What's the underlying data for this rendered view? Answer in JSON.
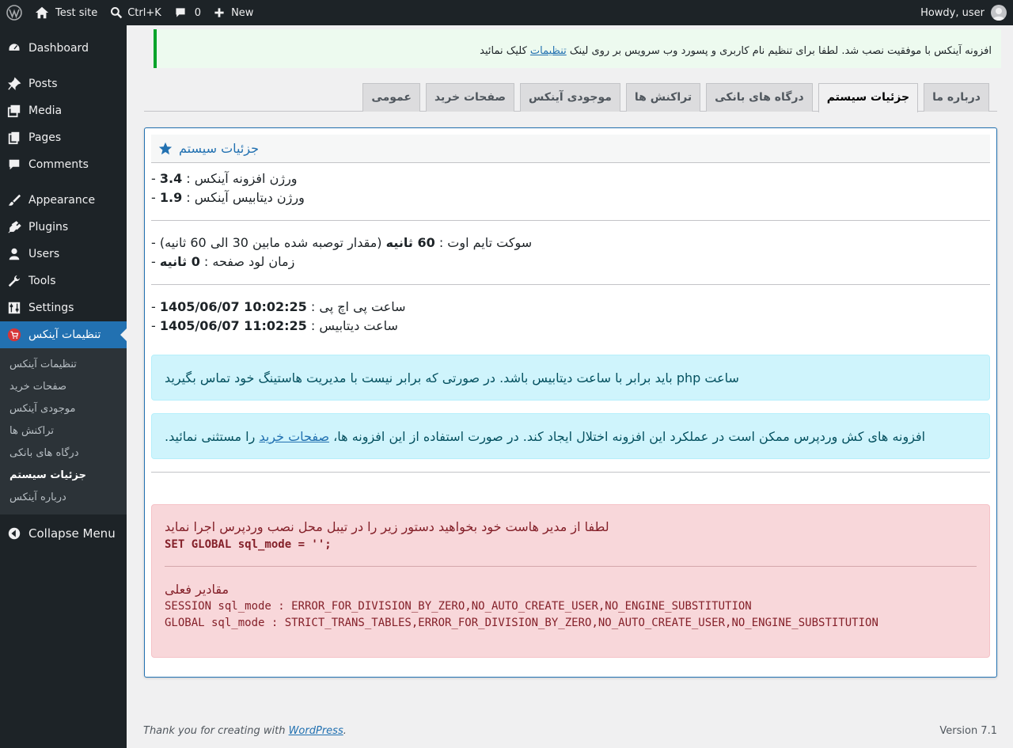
{
  "adminbar": {
    "site_name": "Test site",
    "shortcut": "Ctrl+K",
    "comments_count": "0",
    "new_label": "New",
    "howdy": "Howdy, user"
  },
  "sidebar": {
    "items": [
      {
        "label": "Dashboard",
        "icon": "dashboard-icon"
      },
      {
        "label": "Posts",
        "icon": "pin-icon"
      },
      {
        "label": "Media",
        "icon": "media-icon"
      },
      {
        "label": "Pages",
        "icon": "pages-icon"
      },
      {
        "label": "Comments",
        "icon": "comment-icon"
      },
      {
        "label": "Appearance",
        "icon": "brush-icon"
      },
      {
        "label": "Plugins",
        "icon": "plug-icon"
      },
      {
        "label": "Users",
        "icon": "user-icon"
      },
      {
        "label": "Tools",
        "icon": "wrench-icon"
      },
      {
        "label": "Settings",
        "icon": "sliders-icon"
      },
      {
        "label": "تنظیمات آینکس",
        "icon": "cart-icon"
      }
    ],
    "submenu": [
      "تنظیمات آینکس",
      "صفحات خرید",
      "موجودی آینکس",
      "تراکنش ها",
      "درگاه های بانکی",
      "جزئیات سیستم",
      "درباره آینکس"
    ],
    "collapse_label": "Collapse Menu"
  },
  "notice": {
    "text_before": "افزونه آینکس با موفقیت نصب شد. لطفا برای تنظیم نام کاربری و پسورد وب سرویس بر روی لینک ",
    "link": "تنظیمات",
    "text_after": " کلیک نمائید"
  },
  "tabs": [
    "درباره ما",
    "جزئیات سیستم",
    "درگاه های بانکی",
    "تراکنش ها",
    "موجودی آینکس",
    "صفحات خرید",
    "عمومی"
  ],
  "panel": {
    "title": "جزئیات سیستم",
    "plugin_version_label": "ورژن افزونه آینکس :",
    "plugin_version": "3.4",
    "db_version_label": "ورژن دیتابیس آینکس :",
    "db_version": "1.9",
    "socket_label": "سوکت تایم اوت :",
    "socket_value": "60 ثانیه",
    "socket_note": "(مقدار توصبه شده مابین 30 الی 60 ثانیه)",
    "load_label": "زمان لود صفحه :",
    "load_value": "0 ثانیه",
    "php_time_label": "ساعت پی اچ پی :",
    "php_time": "1405/06/07 10:02:25",
    "db_time_label": "ساعت دیتابیس :",
    "db_time": "1405/06/07 11:02:25",
    "info1": "ساعت php باید برابر با ساعت دیتابیس باشد. در صورتی که برابر نیست با مدیریت هاستینگ خود تماس بگیرید",
    "info2_before": "افزونه های کش وردپرس ممکن است در عملکرد این افزونه اختلال ایجاد کند. در صورت استفاده از این افزونه ها، ",
    "info2_link": "صفحات خرید",
    "info2_after": " را مستثنی نمائید.",
    "danger_text": "لطفا از مدیر هاست خود بخواهید دستور زیر را در تیبل محل نصب وردپرس اجرا نماید",
    "danger_cmd": "SET GLOBAL sql_mode = '';",
    "current_label": "مقادیر فعلی",
    "session_mode": "SESSION sql_mode : ERROR_FOR_DIVISION_BY_ZERO,NO_AUTO_CREATE_USER,NO_ENGINE_SUBSTITUTION",
    "global_mode": "GLOBAL sql_mode : STRICT_TRANS_TABLES,ERROR_FOR_DIVISION_BY_ZERO,NO_AUTO_CREATE_USER,NO_ENGINE_SUBSTITUTION"
  },
  "footer": {
    "thanks_before": "Thank you for creating with ",
    "thanks_link": "WordPress",
    "thanks_after": ".",
    "version": "Version 7.1"
  },
  "colors": {
    "admin_dark": "#1d2327",
    "accent": "#2271b1",
    "success": "#00a32a",
    "info_bg": "#cff4fc",
    "danger_bg": "#f8d7da"
  }
}
